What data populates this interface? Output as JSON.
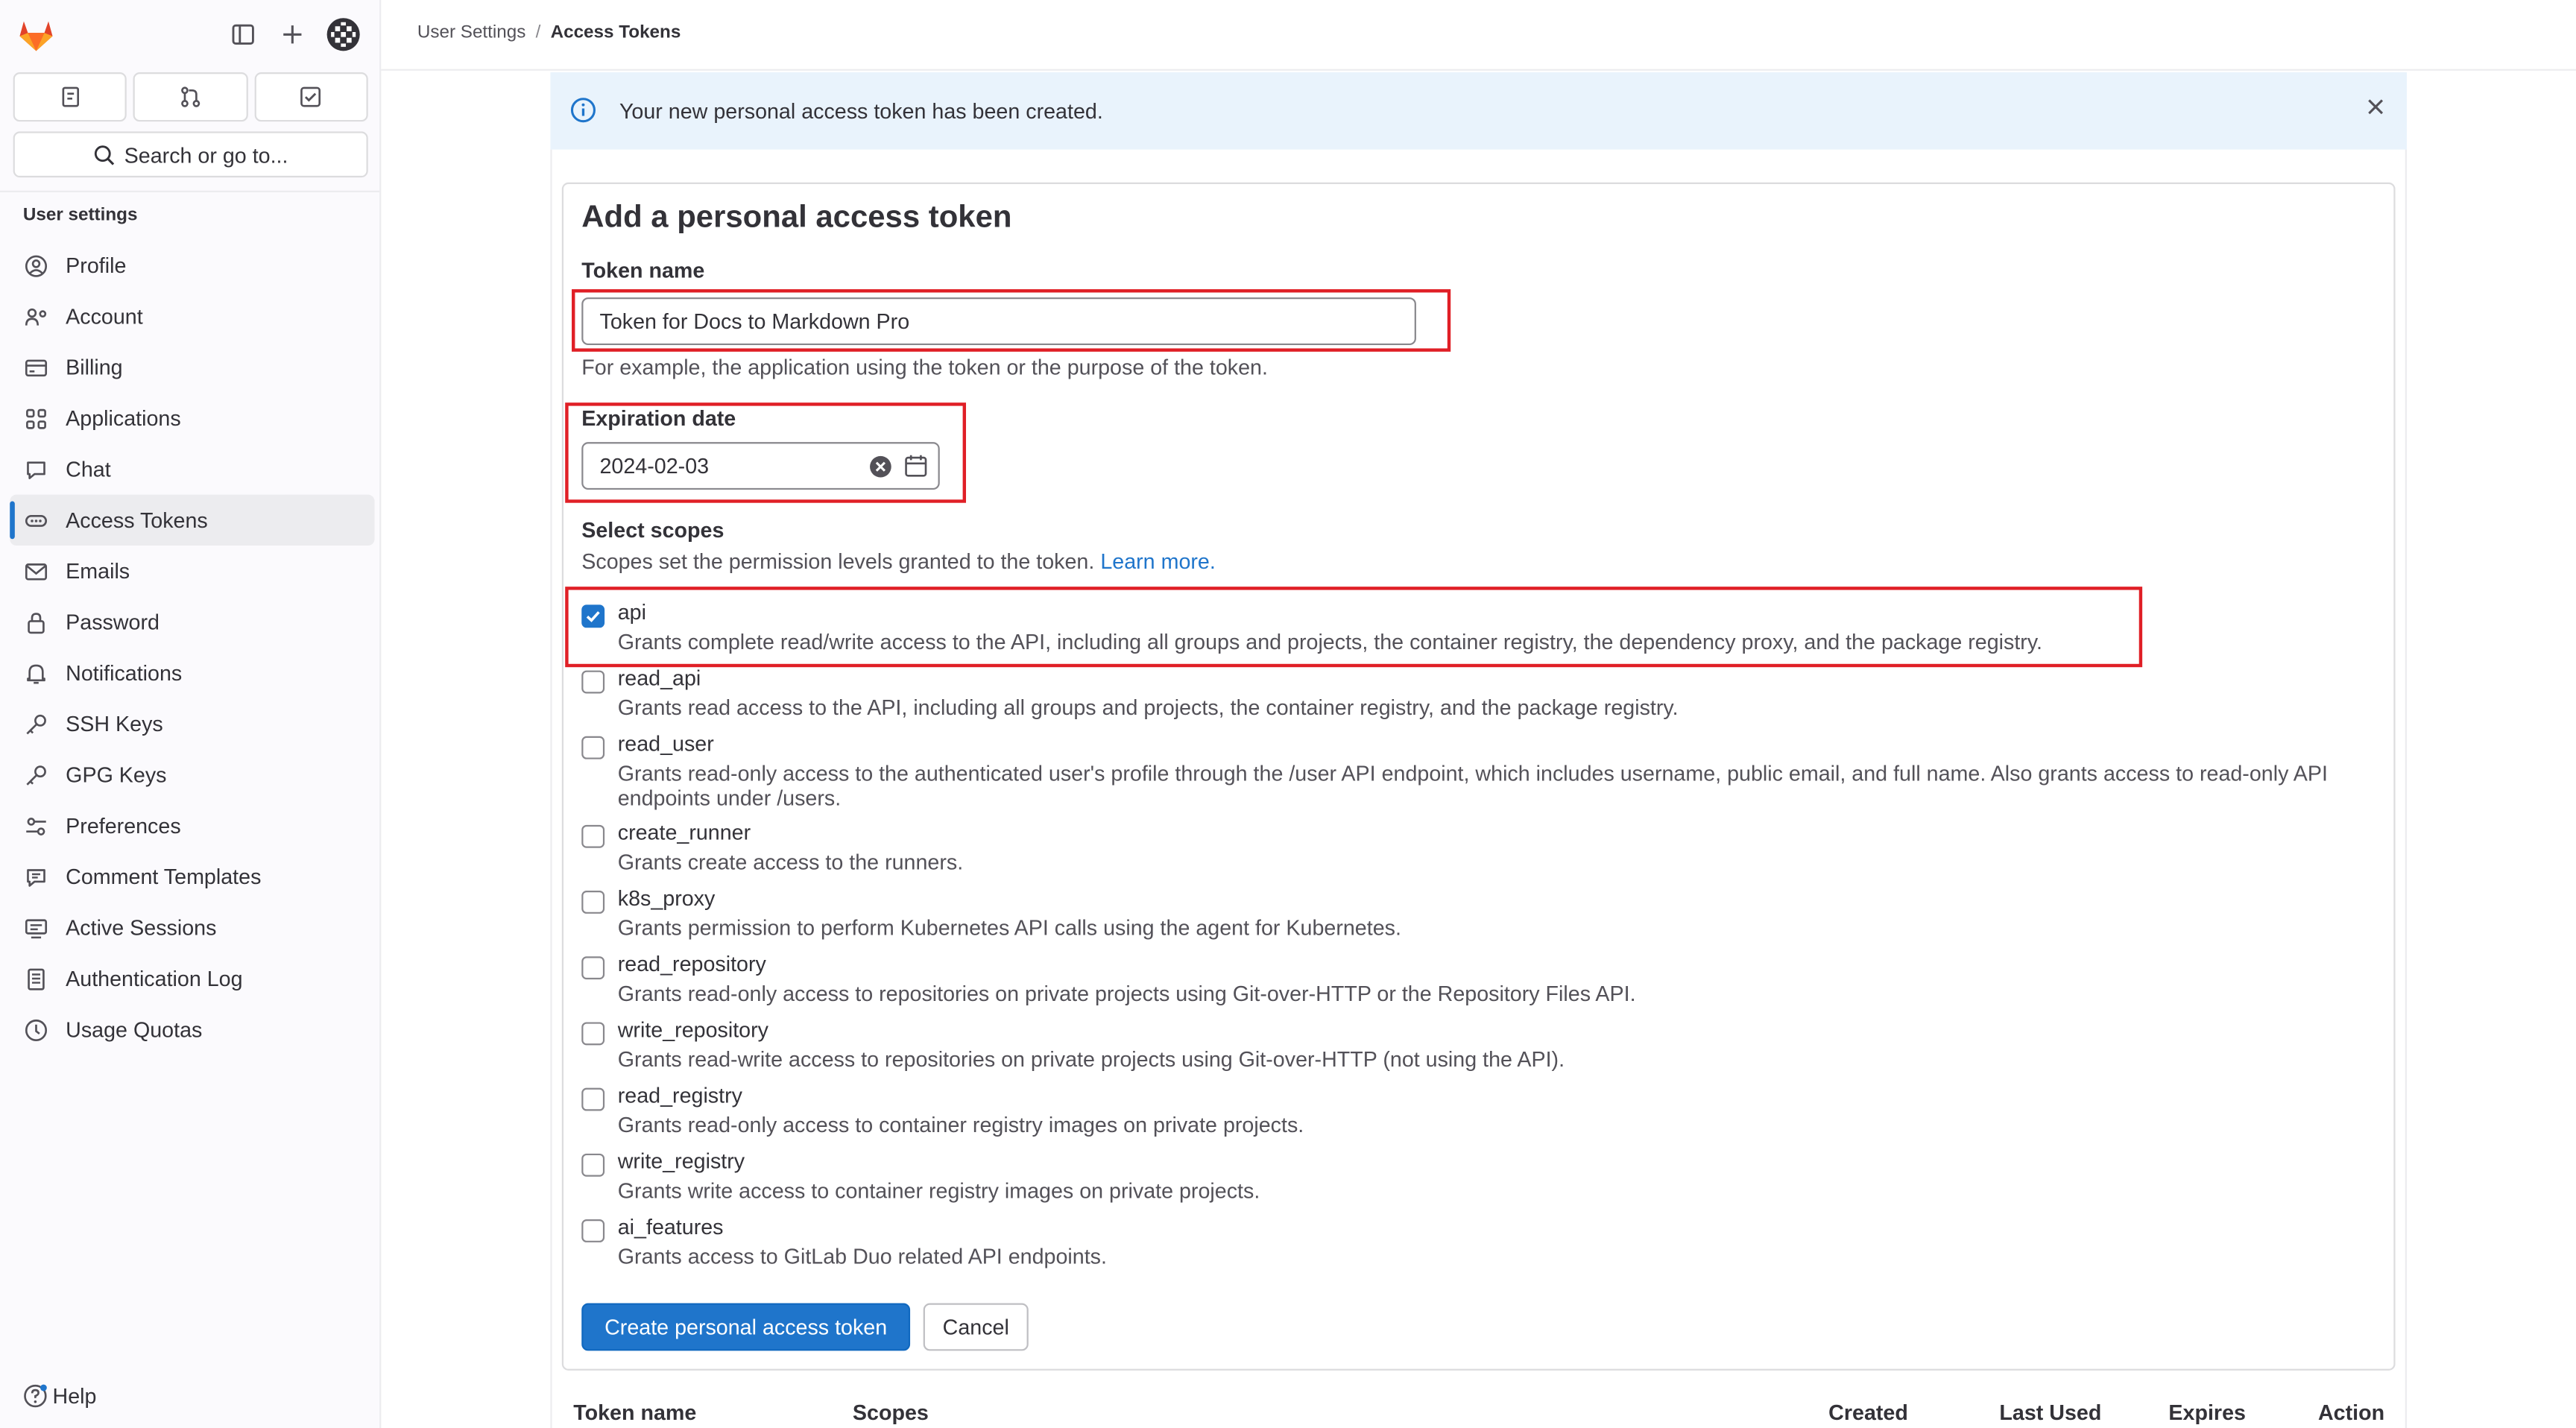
{
  "breadcrumb": {
    "parent": "User Settings",
    "separator": "/",
    "current": "Access Tokens"
  },
  "sidebar": {
    "search_label": "Search or go to...",
    "heading": "User settings",
    "items": [
      {
        "label": "Profile",
        "icon": "profile-icon"
      },
      {
        "label": "Account",
        "icon": "account-icon"
      },
      {
        "label": "Billing",
        "icon": "billing-icon"
      },
      {
        "label": "Applications",
        "icon": "applications-icon"
      },
      {
        "label": "Chat",
        "icon": "chat-icon"
      },
      {
        "label": "Access Tokens",
        "icon": "token-icon",
        "active": true
      },
      {
        "label": "Emails",
        "icon": "mail-icon"
      },
      {
        "label": "Password",
        "icon": "lock-icon"
      },
      {
        "label": "Notifications",
        "icon": "bell-icon"
      },
      {
        "label": "SSH Keys",
        "icon": "key-icon"
      },
      {
        "label": "GPG Keys",
        "icon": "key-icon"
      },
      {
        "label": "Preferences",
        "icon": "preferences-icon"
      },
      {
        "label": "Comment Templates",
        "icon": "comment-icon"
      },
      {
        "label": "Active Sessions",
        "icon": "sessions-icon"
      },
      {
        "label": "Authentication Log",
        "icon": "log-icon"
      },
      {
        "label": "Usage Quotas",
        "icon": "quota-icon"
      }
    ],
    "help_label": "Help"
  },
  "alert": {
    "text": "Your new personal access token has been created."
  },
  "form": {
    "title": "Add a personal access token",
    "token_name_label": "Token name",
    "token_name_value": "Token for Docs to Markdown Pro",
    "token_name_help": "For example, the application using the token or the purpose of the token.",
    "expiration_label": "Expiration date",
    "expiration_value": "2024-02-03",
    "scopes_label": "Select scopes",
    "scopes_help": "Scopes set the permission levels granted to the token.",
    "learn_more": "Learn more.",
    "scopes": [
      {
        "name": "api",
        "checked": true,
        "desc": "Grants complete read/write access to the API, including all groups and projects, the container registry, the dependency proxy, and the package registry."
      },
      {
        "name": "read_api",
        "checked": false,
        "desc": "Grants read access to the API, including all groups and projects, the container registry, and the package registry."
      },
      {
        "name": "read_user",
        "checked": false,
        "desc": "Grants read-only access to the authenticated user's profile through the /user API endpoint, which includes username, public email, and full name. Also grants access to read-only API endpoints under /users."
      },
      {
        "name": "create_runner",
        "checked": false,
        "desc": "Grants create access to the runners."
      },
      {
        "name": "k8s_proxy",
        "checked": false,
        "desc": "Grants permission to perform Kubernetes API calls using the agent for Kubernetes."
      },
      {
        "name": "read_repository",
        "checked": false,
        "desc": "Grants read-only access to repositories on private projects using Git-over-HTTP or the Repository Files API."
      },
      {
        "name": "write_repository",
        "checked": false,
        "desc": "Grants read-write access to repositories on private projects using Git-over-HTTP (not using the API)."
      },
      {
        "name": "read_registry",
        "checked": false,
        "desc": "Grants read-only access to container registry images on private projects."
      },
      {
        "name": "write_registry",
        "checked": false,
        "desc": "Grants write access to container registry images on private projects."
      },
      {
        "name": "ai_features",
        "checked": false,
        "desc": "Grants access to GitLab Duo related API endpoints."
      }
    ],
    "create_label": "Create personal access token",
    "cancel_label": "Cancel"
  },
  "table_headers": {
    "name": "Token name",
    "scopes": "Scopes",
    "created": "Created",
    "last_used": "Last Used",
    "expires": "Expires",
    "action": "Action"
  },
  "colors": {
    "accent": "#1f75cb",
    "highlight": "#e01f26",
    "alert_bg": "#e9f3fc"
  }
}
